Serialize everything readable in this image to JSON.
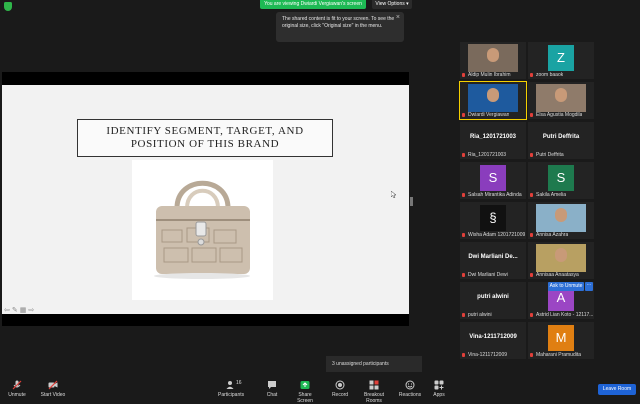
{
  "top": {
    "viewing_label": "You are viewing Dwiardi Vergiawan's screen",
    "view_options": "View Options",
    "tooltip": "The shared content is fit to your screen. To see the original size, click \"Original size\" in the menu."
  },
  "slide": {
    "title_line1": "IDENTIFY SEGMENT, TARGET, AND",
    "title_line2": "POSITION OF THIS BRAND"
  },
  "participants": [
    {
      "name": "Aldip Mulin Ibrahim",
      "type": "photo"
    },
    {
      "name": "zoom baaok",
      "type": "avatar",
      "letter": "Z",
      "color": "#1aa3a3"
    },
    {
      "name": "Dwiardi Vergiawan",
      "type": "photo",
      "active": true
    },
    {
      "name": "Elsa Agustia Mogdila",
      "type": "photo"
    },
    {
      "name": "Ria_1201721003",
      "type": "text",
      "display": "Ria_1201721003"
    },
    {
      "name": "Putri Deffrita",
      "type": "text",
      "display": "Putri Deffrita"
    },
    {
      "name": "Salsah Mirantika Adinda",
      "type": "avatar",
      "letter": "S",
      "color": "#8a3dbd"
    },
    {
      "name": "Sakila Amelia",
      "type": "avatar",
      "letter": "S",
      "color": "#1e7a4e"
    },
    {
      "name": "Wisha Adam 1201721009",
      "type": "avatar",
      "letter": "§",
      "color": "#111111"
    },
    {
      "name": "Annisa Azahra",
      "type": "photo"
    },
    {
      "name": "Dwi Marliani Dewi",
      "type": "text",
      "display": "Dwi Marliani De..."
    },
    {
      "name": "Annisaa Anaatasya",
      "type": "photo"
    },
    {
      "name": "putri alwini",
      "type": "text",
      "display": "putri alwini"
    },
    {
      "name": "Astrid Lian Koto - 12117...",
      "type": "avatar",
      "letter": "A",
      "color": "#9b46c4"
    },
    {
      "name": "Vina-1211712009",
      "type": "text",
      "display": "Vina-1211712009"
    },
    {
      "name": "Maharani Pramudita",
      "type": "avatar",
      "letter": "M",
      "color": "#e07f12"
    }
  ],
  "ask_to_unmute": "Ask to Unmute",
  "unassigned": "3 unassigned participants",
  "toolbar": {
    "unmute": "Unmute",
    "start_video": "Start Video",
    "participants": "Participants",
    "participants_count": "16",
    "chat": "Chat",
    "share_screen": "Share Screen",
    "record": "Record",
    "breakout_rooms": "Breakout Rooms",
    "reactions": "Reactions",
    "apps": "Apps",
    "leave": "Leave Room"
  },
  "colors": {
    "share_green": "#1db954",
    "leave_blue": "#1e63d6",
    "muted_red": "#e0403a"
  }
}
